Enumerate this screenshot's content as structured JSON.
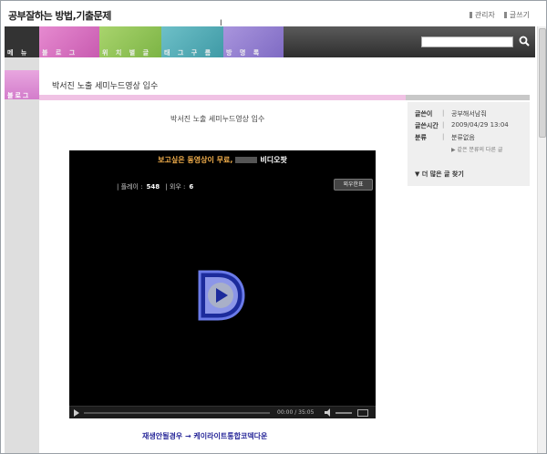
{
  "header": {
    "site_title": "공부잘하는 방법,기출문제",
    "links": [
      "관리자",
      "글쓰기"
    ],
    "cursor": "I"
  },
  "nav": {
    "tabs": [
      "메 뉴",
      "블 로 그",
      "위 치 별 글",
      "태 그 구 름",
      "방 명 록"
    ],
    "search_placeholder": ""
  },
  "sidebar": {
    "active_label": "블로그"
  },
  "post": {
    "title": "박서진 노출 세미누드영상 입수",
    "subtitle": "박서진 노출 세미누드영상 입수",
    "link_text": "재생안될경우 → 케이라이트통합코덱다운"
  },
  "info": {
    "author_label": "글쓴이",
    "author": "공부해서남줘",
    "time_label": "글쓴시간",
    "time": "2009/04/29 13:04",
    "category_label": "분류",
    "category": "분류없음",
    "related": "▶ 같은 분류의 다른 글",
    "more": "▼ 더 많은 글 찾기"
  },
  "video": {
    "header_orange": "보고싶은 동영상이 무료,",
    "header_white": "비디오팟",
    "play_label": "| 플레이 :",
    "play_count": "548",
    "out_label": "| 외우 :",
    "out_count": "6",
    "button": "외우한표",
    "time": "00:00 / 35:05"
  },
  "colors": {
    "nav_bg": "#3a3a3a",
    "blog_pink": "#d37ccb",
    "link_blue": "#2a2a9a",
    "video_logo": "#4a5bd0"
  }
}
